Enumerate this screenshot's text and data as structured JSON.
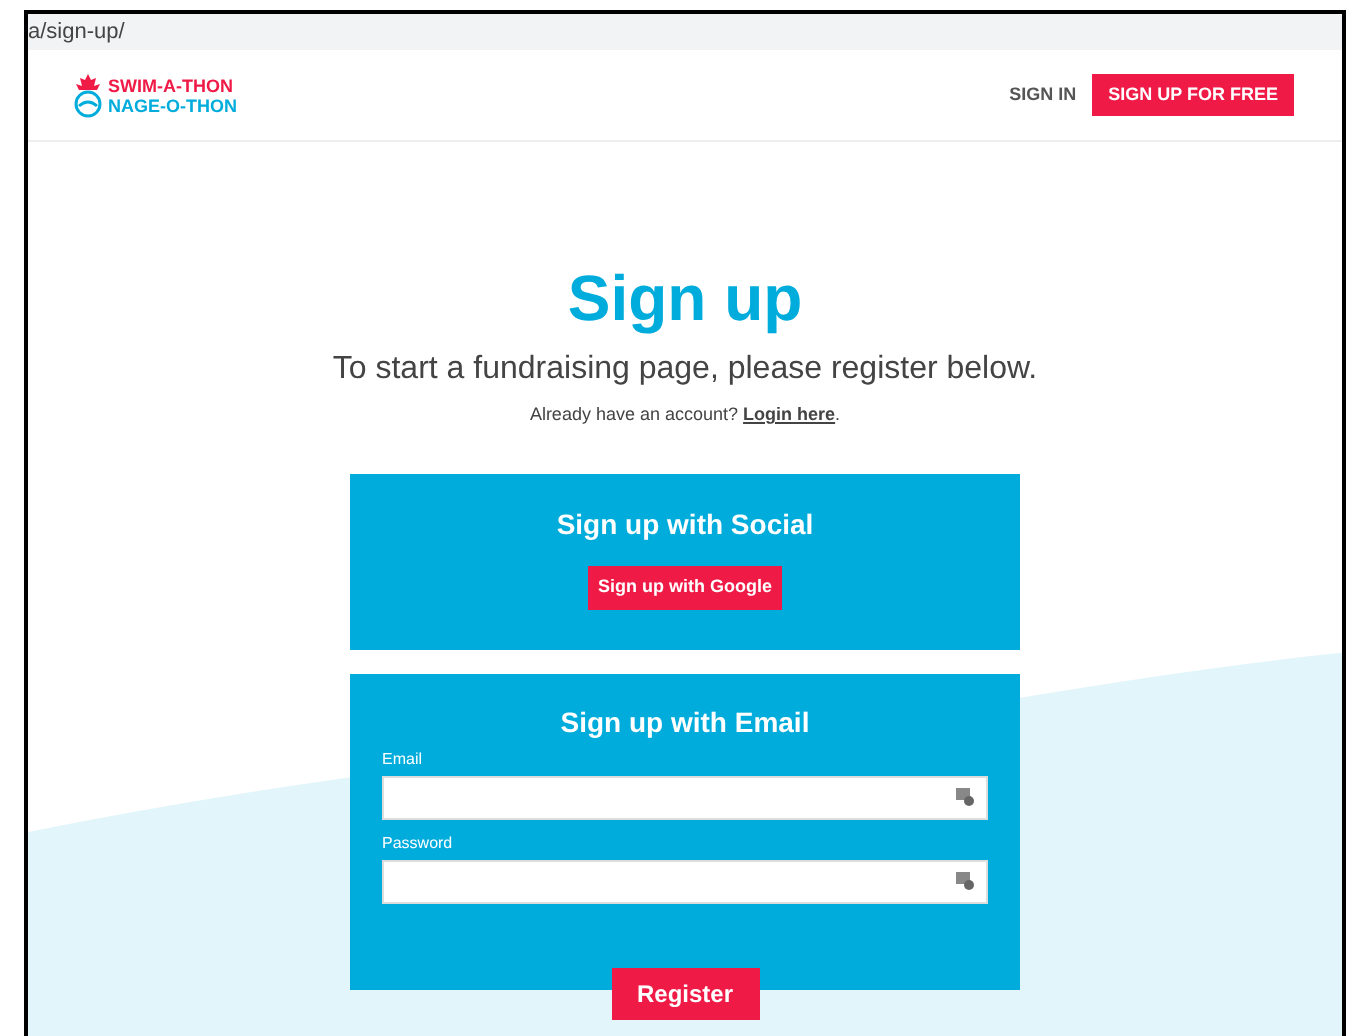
{
  "address_bar": {
    "url": "a/sign-up/"
  },
  "header": {
    "logo_top": "SWIM-A-THON",
    "logo_bottom": "NAGE-O-THON",
    "sign_in": "SIGN IN",
    "sign_up": "SIGN UP FOR FREE"
  },
  "title": "Sign up",
  "subtitle": "To start a fundraising page, please register below.",
  "login_prompt": {
    "text": "Already have an account?",
    "link": "Login here",
    "after": "."
  },
  "social": {
    "heading": "Sign up with Social",
    "button": "Sign up with Google"
  },
  "email_form": {
    "heading": "Sign up with Email",
    "fields": [
      {
        "label": "Email"
      },
      {
        "label": "Password"
      }
    ],
    "button": "Register"
  }
}
